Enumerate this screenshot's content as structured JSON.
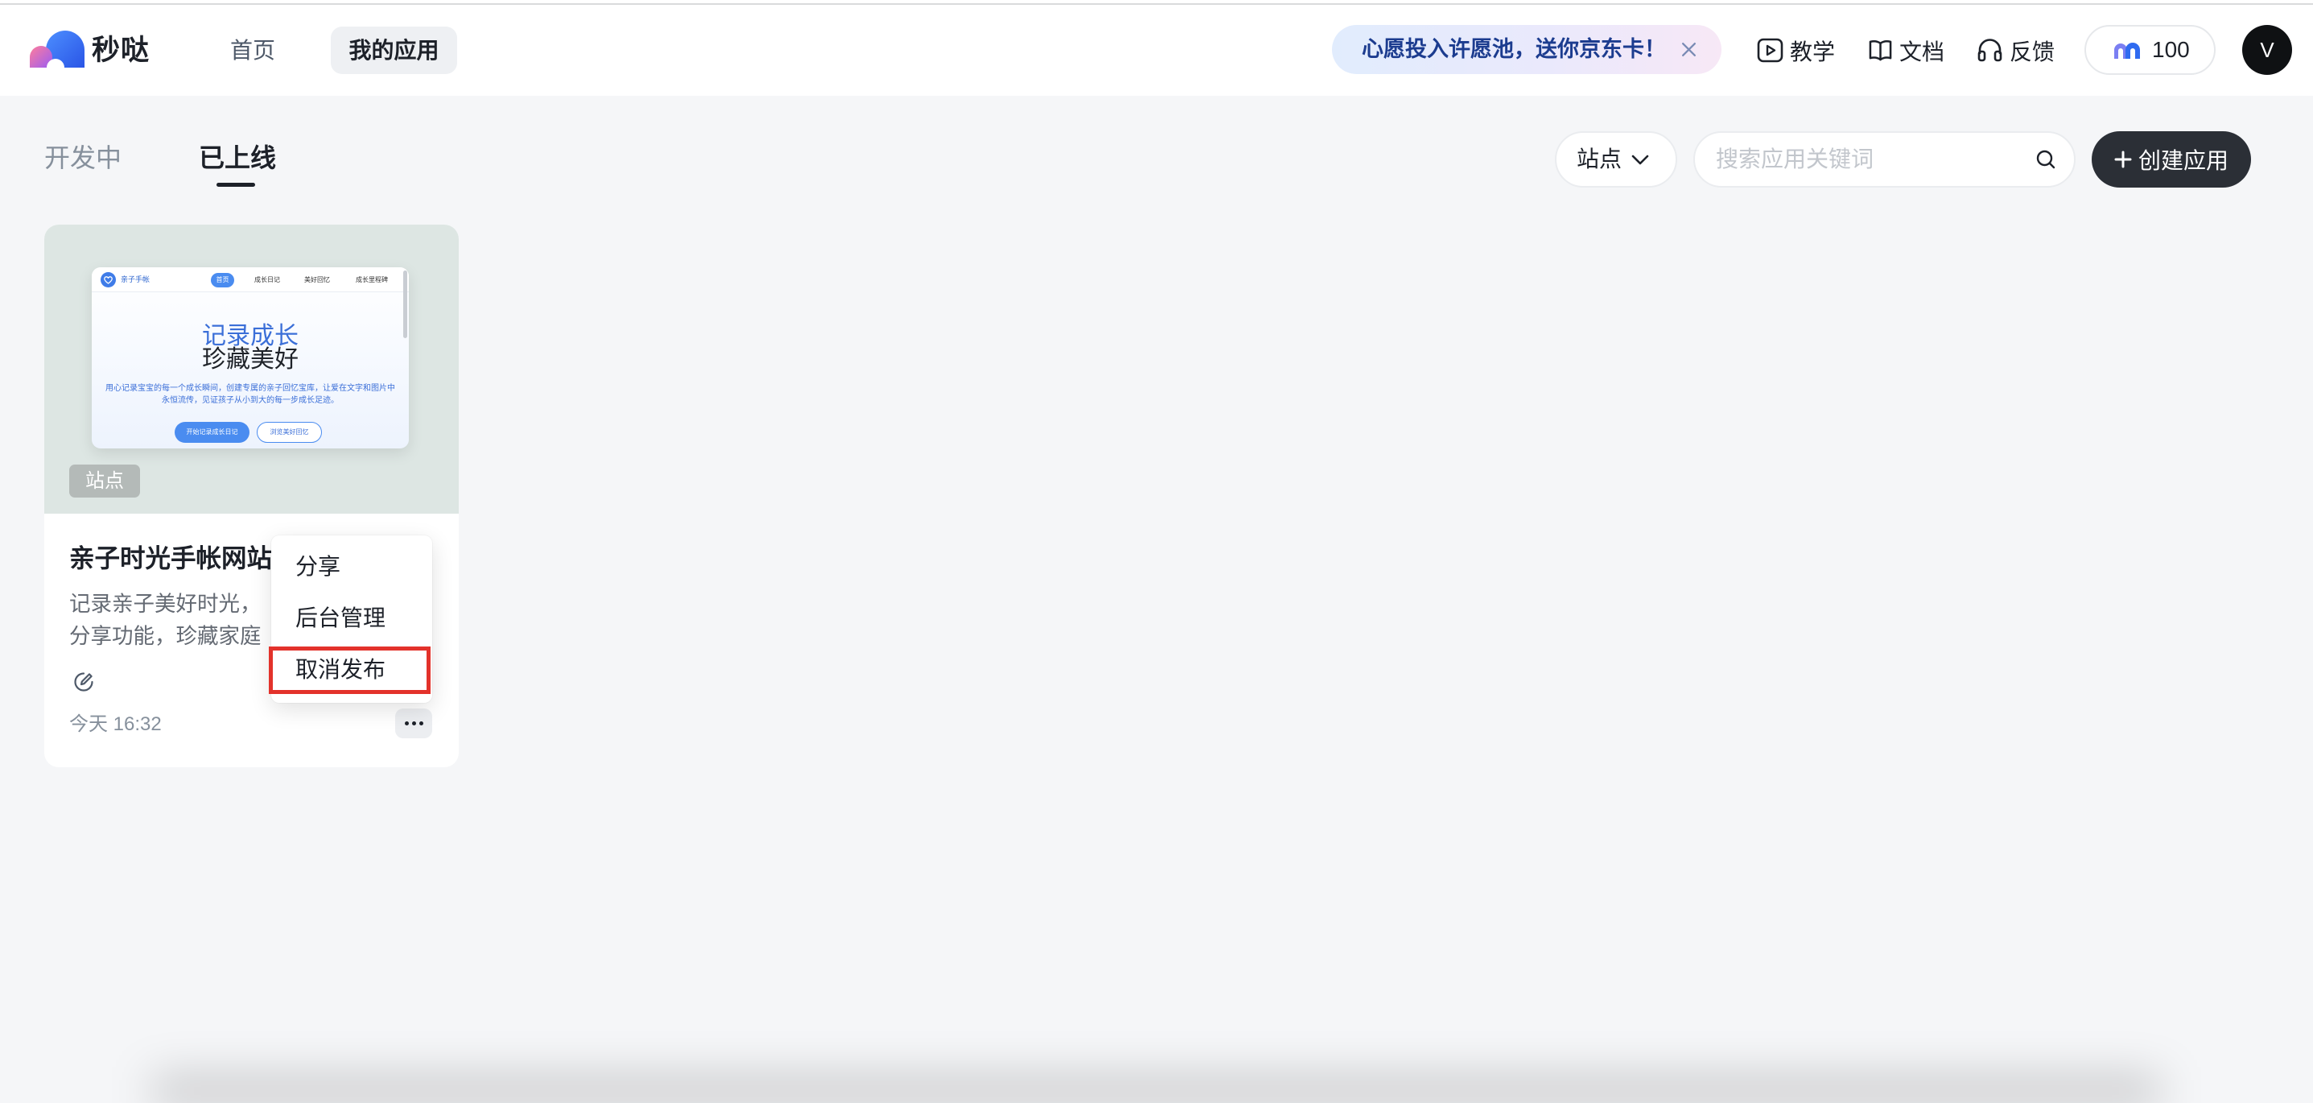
{
  "theme": {
    "accent_dark": "#2b2f36",
    "highlight_border": "#e3322b",
    "preview_blue": "#4a8cf0",
    "preview_text_blue": "#3b6fd8",
    "banner_text": "#1c3c8f"
  },
  "header": {
    "app_name": "秒哒",
    "logo_icon": "miaoda-logo-icon",
    "nav": [
      {
        "label": "首页",
        "active": false
      },
      {
        "label": "我的应用",
        "active": true
      }
    ],
    "promo_banner": {
      "text": "心愿投入许愿池，送你京东卡！",
      "close_icon": "close-icon"
    },
    "links": [
      {
        "label": "教学",
        "icon": "play-icon"
      },
      {
        "label": "文档",
        "icon": "book-icon"
      },
      {
        "label": "反馈",
        "icon": "headset-icon"
      }
    ],
    "credits": {
      "icon": "credits-icon",
      "value": "100"
    },
    "avatar": {
      "initial": "V"
    }
  },
  "toolbar": {
    "tabs": [
      {
        "label": "开发中",
        "active": false
      },
      {
        "label": "已上线",
        "active": true
      }
    ],
    "type_filter": {
      "selected": "站点",
      "icon": "chevron-down-icon"
    },
    "search": {
      "placeholder": "搜索应用关键词",
      "value": "",
      "icon": "search-icon"
    },
    "create_button": {
      "label": "创建应用",
      "icon": "plus-icon"
    }
  },
  "apps": [
    {
      "title": "亲子时光手帐网站",
      "type_badge": "站点",
      "description_lines": [
        "记录亲子美好时光，",
        "分享功能，珍藏家庭"
      ],
      "updated": "今天 16:32",
      "edit_icon": "edit-icon",
      "more_icon": "more-dots-icon",
      "preview": {
        "brand": "亲子手帐",
        "brand_icon": "heart-icon",
        "nav": [
          {
            "label": "首页",
            "active": true
          },
          {
            "label": "成长日记",
            "active": false
          },
          {
            "label": "美好回忆",
            "active": false
          },
          {
            "label": "成长里程碑",
            "active": false
          }
        ],
        "headline": [
          "记录成长",
          "珍藏美好"
        ],
        "subtitle_lines": [
          "用心记录宝宝的每一个成长瞬间，创建专属的亲子回忆宝库，让爱在文字和图片中",
          "永恒流传，见证孩子从小到大的每一步成长足迹。"
        ],
        "buttons": [
          {
            "label": "开始记录成长日记",
            "filled": true
          },
          {
            "label": "浏览美好回忆",
            "filled": false
          }
        ]
      }
    }
  ],
  "context_menu": {
    "open": true,
    "items": [
      {
        "label": "分享"
      },
      {
        "label": "后台管理"
      },
      {
        "label": "取消发布"
      }
    ],
    "highlighted_index": 2
  }
}
